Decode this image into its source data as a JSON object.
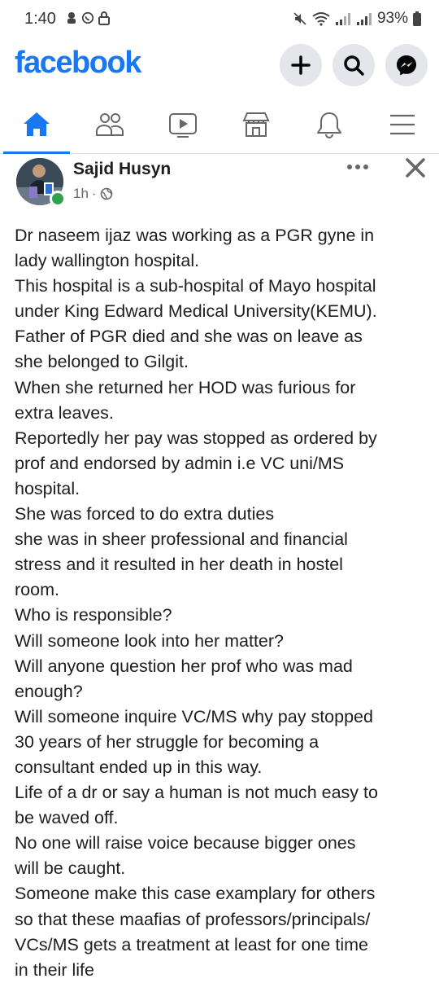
{
  "status_bar": {
    "time": "1:40",
    "battery": "93%"
  },
  "header": {
    "logo": "facebook",
    "brand_color": "#1877f2",
    "buttons": [
      "plus-icon",
      "search-icon",
      "messenger-icon"
    ]
  },
  "nav": {
    "items": [
      "home-icon",
      "friends-icon",
      "video-icon",
      "marketplace-icon",
      "notifications-icon",
      "menu-icon"
    ],
    "active": "home"
  },
  "post": {
    "author": "Sajid Husyn",
    "time": "1h",
    "separator": "·",
    "lines": [
      "Dr naseem ijaz was working as a PGR gyne in",
      "lady wallington hospital.",
      "This hospital is a sub-hospital of Mayo hospital",
      "under King Edward Medical University(KEMU).",
      "Father of PGR died and she was on leave as",
      "she belonged to Gilgit.",
      "When she returned her HOD was furious for",
      "extra leaves.",
      "Reportedly her pay was stopped as ordered by",
      "prof and endorsed by admin i.e VC uni/MS",
      "hospital.",
      "She was forced to do extra duties",
      "she was in sheer professional and financial",
      "stress and it resulted in her death in hostel",
      "room.",
      "Who is responsible?",
      "Will someone look into her matter?",
      "Will anyone question her prof who was mad",
      "enough?",
      "Will someone inquire VC/MS why pay stopped",
      "30 years of her struggle for becoming a",
      "consultant ended up in this way.",
      "Life of a dr or say a human is not much easy to",
      "be waved off.",
      "No one will raise voice because bigger ones",
      "will be caught.",
      "Someone make this case examplary for others",
      "so that these maafias of professors/principals/",
      "VCs/MS gets a treatment at least for one time",
      "in their life"
    ]
  }
}
